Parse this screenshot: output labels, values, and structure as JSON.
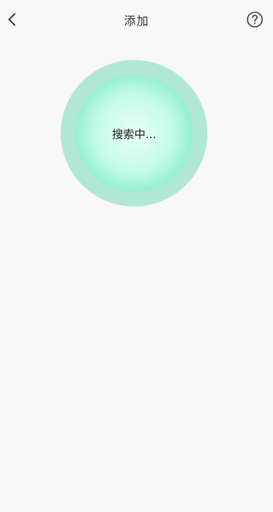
{
  "header": {
    "title": "添加",
    "back_icon": "chevron-left-icon",
    "help_icon": "question-circle-icon"
  },
  "search": {
    "status_text": "搜索中..."
  },
  "colors": {
    "background": "#f8f8f8",
    "radar_outer": "#b0e8d5",
    "radar_inner_edge": "#57dfad",
    "radar_inner_center": "#eafff8"
  }
}
